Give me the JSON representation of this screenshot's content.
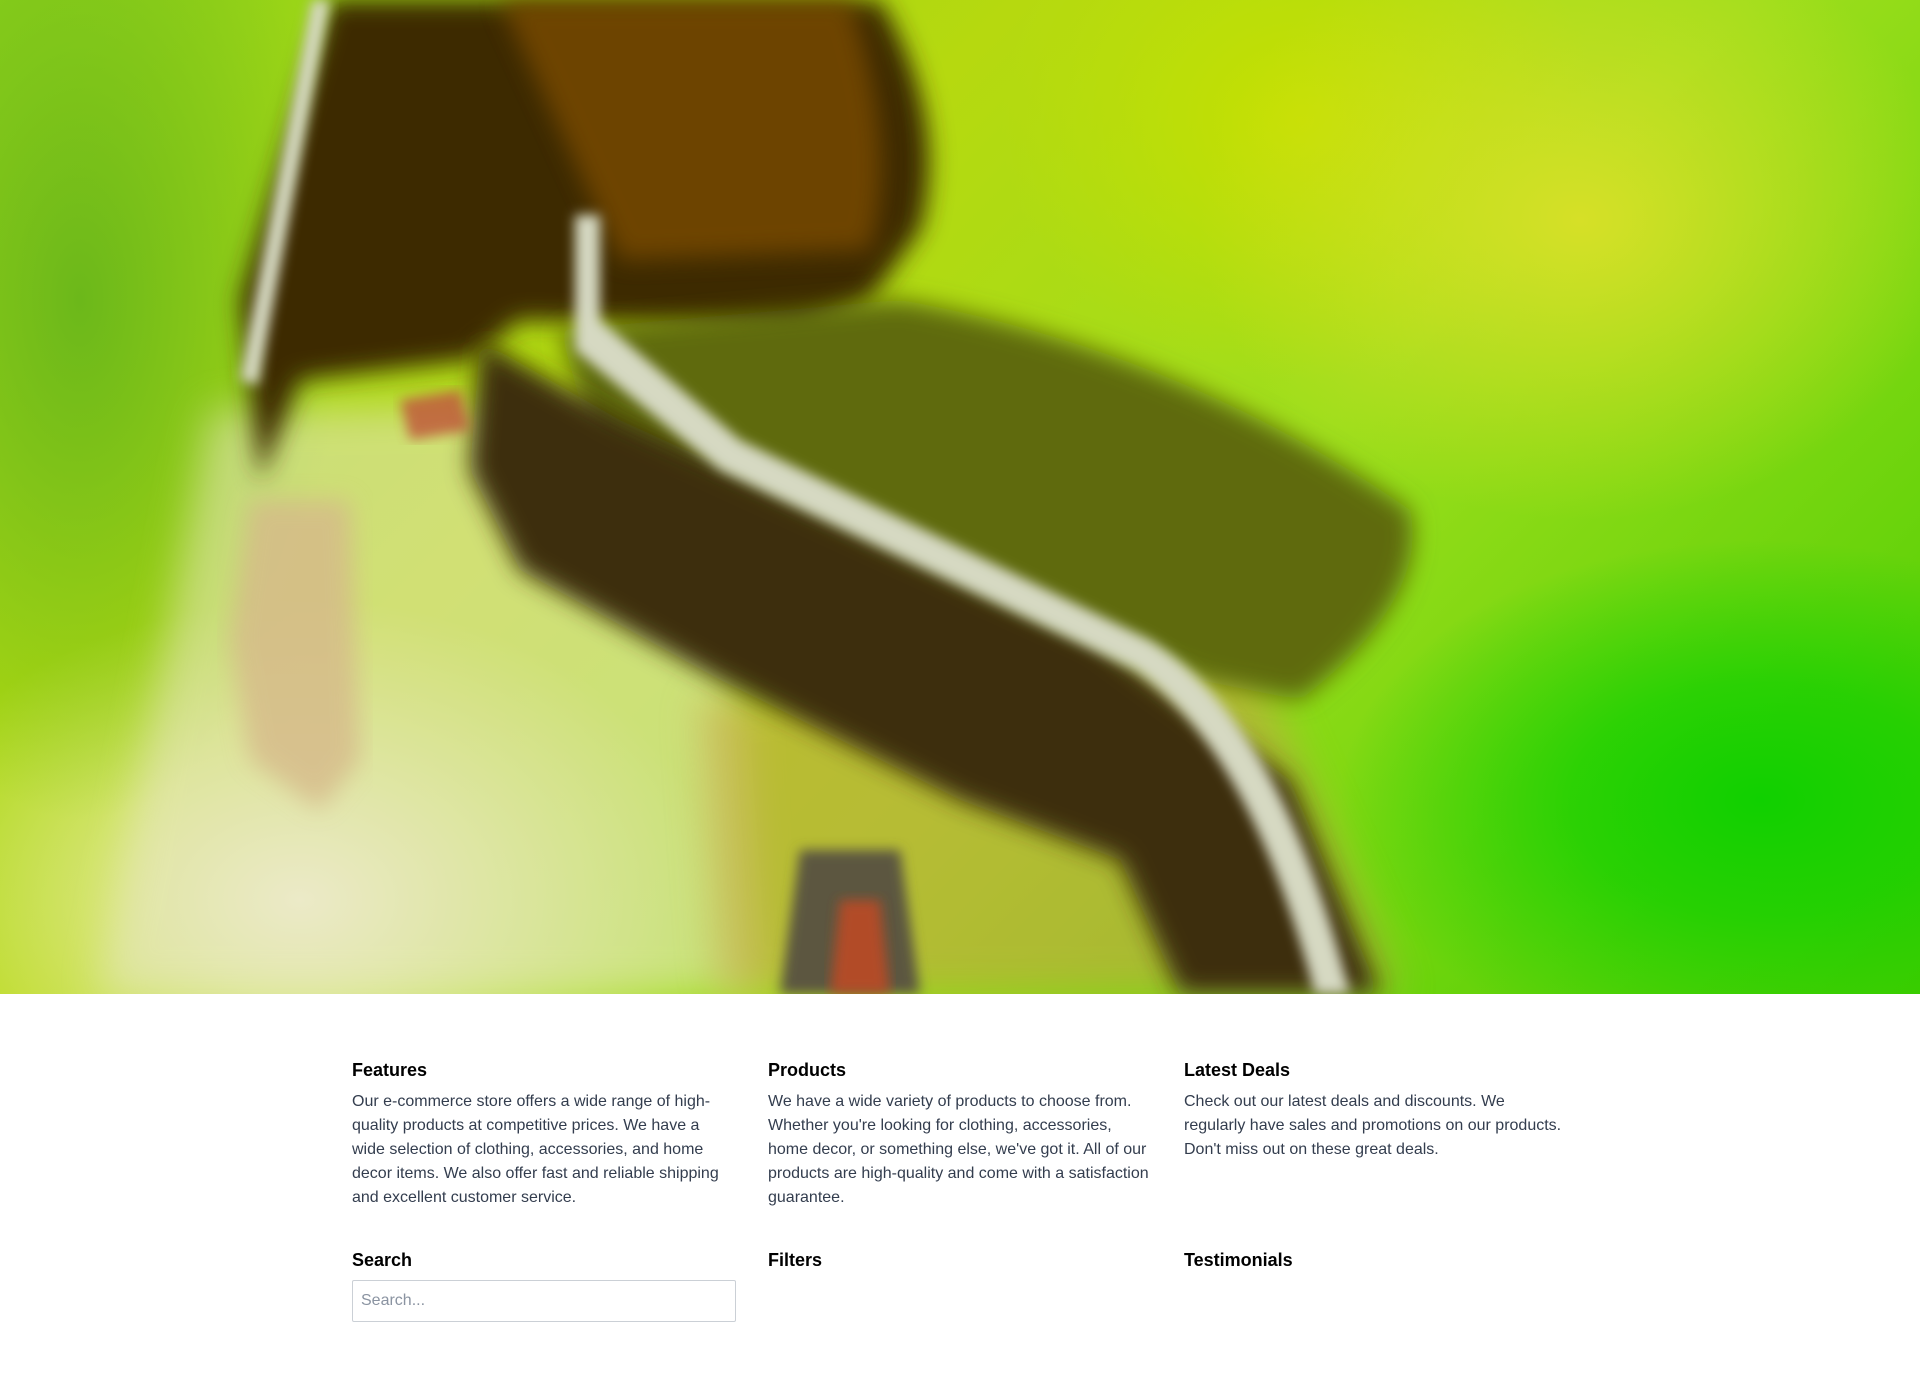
{
  "hero": {
    "image_description_icon": "hero-photo"
  },
  "sections": {
    "features": {
      "title": "Features",
      "text": "Our e-commerce store offers a wide range of high-quality products at competitive prices. We have a wide selection of clothing, accessories, and home decor items. We also offer fast and reliable shipping and excellent customer service."
    },
    "products": {
      "title": "Products",
      "text": "We have a wide variety of products to choose from. Whether you're looking for clothing, accessories, home decor, or something else, we've got it. All of our products are high-quality and come with a satisfaction guarantee."
    },
    "latest_deals": {
      "title": "Latest Deals",
      "text": "Check out our latest deals and discounts. We regularly have sales and promotions on our products. Don't miss out on these great deals."
    },
    "search": {
      "title": "Search",
      "placeholder": "Search..."
    },
    "filters": {
      "title": "Filters"
    },
    "testimonials": {
      "title": "Testimonials"
    }
  }
}
